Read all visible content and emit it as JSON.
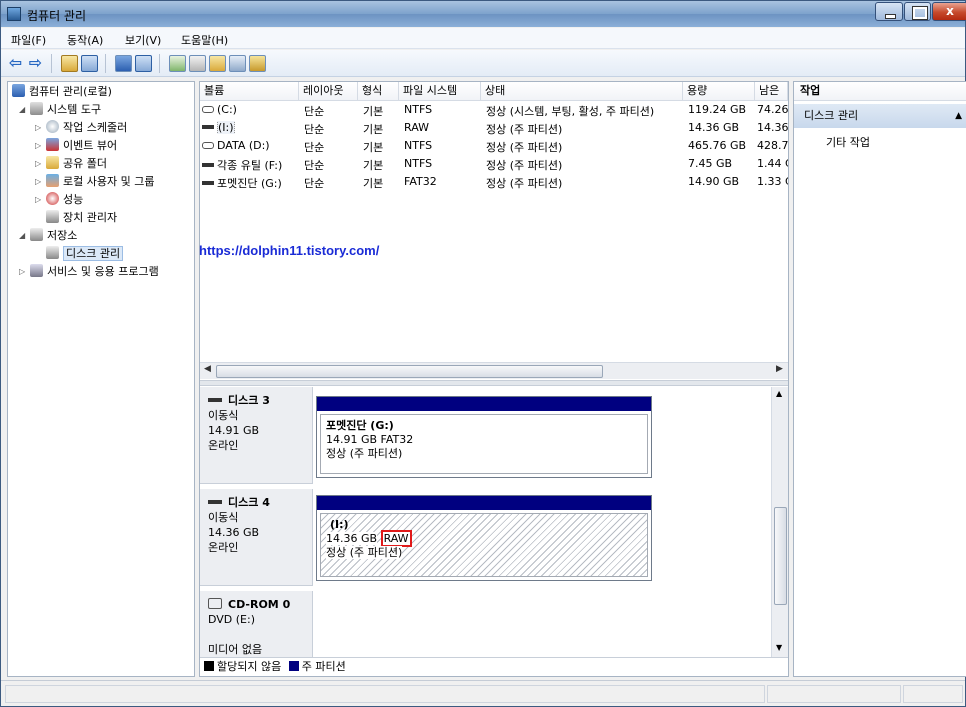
{
  "window": {
    "title": "컴퓨터 관리"
  },
  "menu": [
    "파일(F)",
    "동작(A)",
    "보기(V)",
    "도움말(H)"
  ],
  "tree": {
    "root": "컴퓨터 관리(로컬)",
    "system_tools": "시스템 도구",
    "task_scheduler": "작업 스케줄러",
    "event_viewer": "이벤트 뷰어",
    "shared_folders": "공유 폴더",
    "local_users": "로컬 사용자 및 그룹",
    "performance": "성능",
    "device_manager": "장치 관리자",
    "storage": "저장소",
    "disk_management": "디스크 관리",
    "services": "서비스 및 응용 프로그램"
  },
  "volume_list": {
    "columns": [
      "볼륨",
      "레이아웃",
      "형식",
      "파일 시스템",
      "상태",
      "용량",
      "남은"
    ],
    "rows": [
      [
        "(C:)",
        "단순",
        "기본",
        "NTFS",
        "정상 (시스템, 부팅, 활성, 주 파티션)",
        "119.24 GB",
        "74.26"
      ],
      [
        "(I:)",
        "단순",
        "기본",
        "RAW",
        "정상 (주 파티션)",
        "14.36 GB",
        "14.36"
      ],
      [
        "DATA (D:)",
        "단순",
        "기본",
        "NTFS",
        "정상 (주 파티션)",
        "465.76 GB",
        "428.7"
      ],
      [
        "각종 유틸 (F:)",
        "단순",
        "기본",
        "NTFS",
        "정상 (주 파티션)",
        "7.45 GB",
        "1.44 C"
      ],
      [
        "포멧진단 (G:)",
        "단순",
        "기본",
        "FAT32",
        "정상 (주 파티션)",
        "14.90 GB",
        "1.33 C"
      ]
    ]
  },
  "watermark": "https://dolphin11.tistory.com/",
  "disks": {
    "disk3": {
      "name": "디스크 3",
      "type": "이동식",
      "size": "14.91 GB",
      "status": "온라인",
      "part_name": "포멧진단  (G:)",
      "part_size": "14.91 GB FAT32",
      "part_status": "정상 (주 파티션)"
    },
    "disk4": {
      "name": "디스크 4",
      "type": "이동식",
      "size": "14.36 GB",
      "status": "온라인",
      "part_name": "(I:)",
      "part_size": "14.36 GB",
      "part_fs": "RAW",
      "part_status": "정상 (주 파티션)"
    },
    "cdrom": {
      "name": "CD-ROM 0",
      "type": "DVD (E:)",
      "status": "미디어 없음"
    }
  },
  "legend": {
    "unallocated": "할당되지 않음",
    "primary": "주 파티션"
  },
  "actions": {
    "header": "작업",
    "section": "디스크 관리",
    "item": "기타 작업"
  },
  "colors": {
    "primary_partition": "#000080",
    "highlight": "#e11a1a"
  }
}
